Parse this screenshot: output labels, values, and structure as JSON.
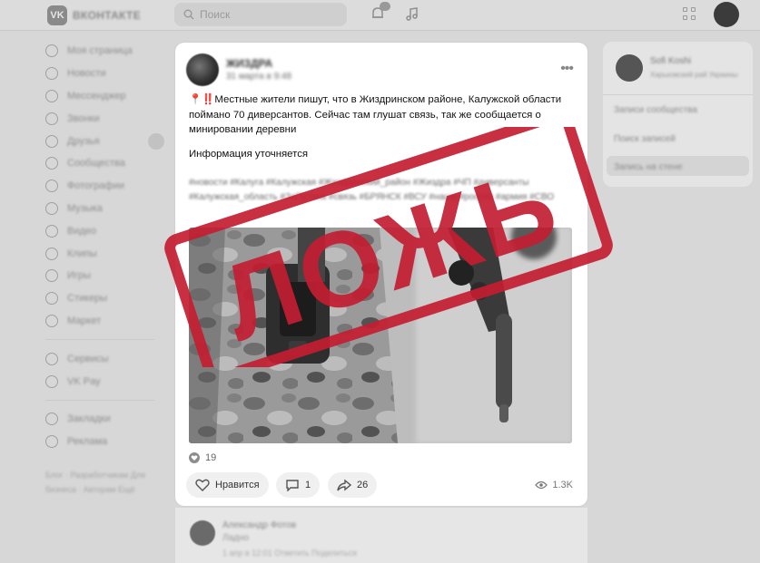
{
  "header": {
    "logo_text": "ВКОНТАКТЕ",
    "search_placeholder": "Поиск"
  },
  "sidebar": {
    "items": [
      {
        "label": "Моя страница"
      },
      {
        "label": "Новости"
      },
      {
        "label": "Мессенджер"
      },
      {
        "label": "Звонки"
      },
      {
        "label": "Друзья"
      },
      {
        "label": "Сообщества"
      },
      {
        "label": "Фотографии"
      },
      {
        "label": "Музыка"
      },
      {
        "label": "Видео"
      },
      {
        "label": "Клипы"
      },
      {
        "label": "Игры"
      },
      {
        "label": "Стикеры"
      },
      {
        "label": "Маркет"
      }
    ],
    "items2": [
      {
        "label": "Сервисы"
      },
      {
        "label": "VK Pay"
      }
    ],
    "items3": [
      {
        "label": "Закладки"
      },
      {
        "label": "Реклама"
      }
    ],
    "footer": "Блог · Разработчикам Для бизнеса · Авторам Ещё"
  },
  "right_panel": {
    "name": "Sofi Koshi",
    "subtitle": "Харьковский рай Украины",
    "items": [
      "Записи сообщества",
      "Поиск записей",
      "Запись на стене"
    ]
  },
  "post": {
    "author": "ЖИЗДРА",
    "date": "31 марта в 9:48",
    "more_icon": "more-horizontal-icon",
    "text": "📍‼️Местные жители пишут, что в Жиздринском районе, Калужской области поймано 70 диверсантов. Сейчас там глушат связь, так же сообщается о минировании деревни",
    "info": "Информация уточняется",
    "tags": "#новости #Калуга #Калужская #Жиздринский_район #Жиздра #ЧП #диверсанты #Калужская_область #ЗаПутина #связь #БРЯНСК #ВСУ #наши #россия #армия #СВО",
    "likes_count": "19",
    "like_label": "Нравится",
    "comments_count": "1",
    "shares_count": "26",
    "views": "1.3K"
  },
  "comment": {
    "author": "Александр Фотов",
    "text": "Ладно",
    "meta": "1 апр в 12:01   Ответить   Поделиться"
  },
  "stamp": {
    "text": "ЛОЖЬ",
    "color": "#c31e32"
  }
}
